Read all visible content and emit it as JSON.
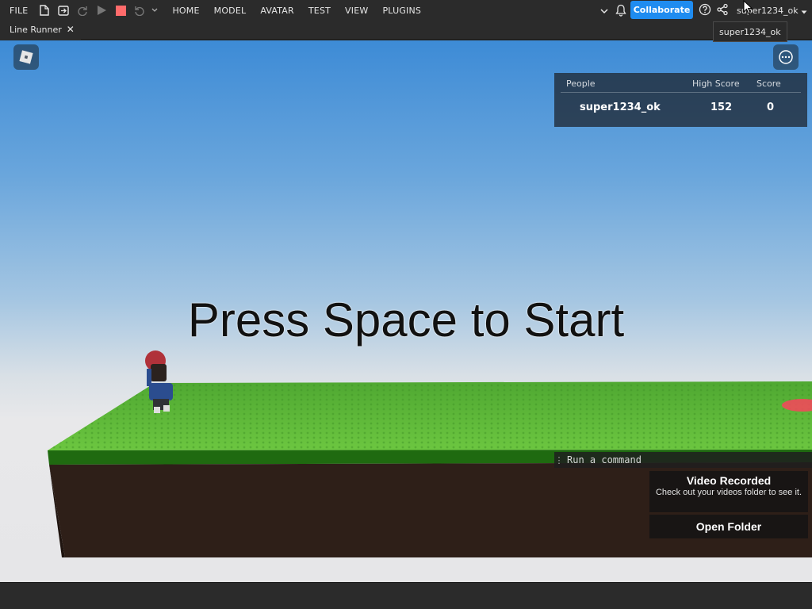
{
  "menubar": {
    "file": "FILE",
    "tabs": [
      "HOME",
      "MODEL",
      "AVATAR",
      "TEST",
      "VIEW",
      "PLUGINS"
    ],
    "collaborate": "Collaborate",
    "username": "super1234_ok"
  },
  "tabbar": {
    "tab_label": "Line Runner",
    "close_glyph": "✕"
  },
  "tooltip": {
    "text": "super1234_ok"
  },
  "game": {
    "center_message": "Press Space to Start",
    "leaderboard": {
      "headers": [
        "People",
        "High Score",
        "Score"
      ],
      "rows": [
        {
          "name": "super1234_ok",
          "high_score": "152",
          "score": "0"
        }
      ]
    },
    "command_bar": {
      "placeholder": "Run a command"
    },
    "toast": {
      "title": "Video Recorded",
      "description": "Check out your videos folder to see it.",
      "button": "Open Folder"
    }
  },
  "colors": {
    "accent": "#1f8cf0",
    "stop": "#ff6b6b",
    "grass": "#5bb83a",
    "dirt": "#2e1f18"
  },
  "icons": [
    "new-file-icon",
    "open-file-icon",
    "redo-icon",
    "play-icon",
    "stop-icon",
    "undo-icon",
    "chevron-down-icon",
    "bell-icon",
    "help-icon",
    "share-icon",
    "roblox-logo-icon",
    "more-icon",
    "drag-grip-icon"
  ]
}
